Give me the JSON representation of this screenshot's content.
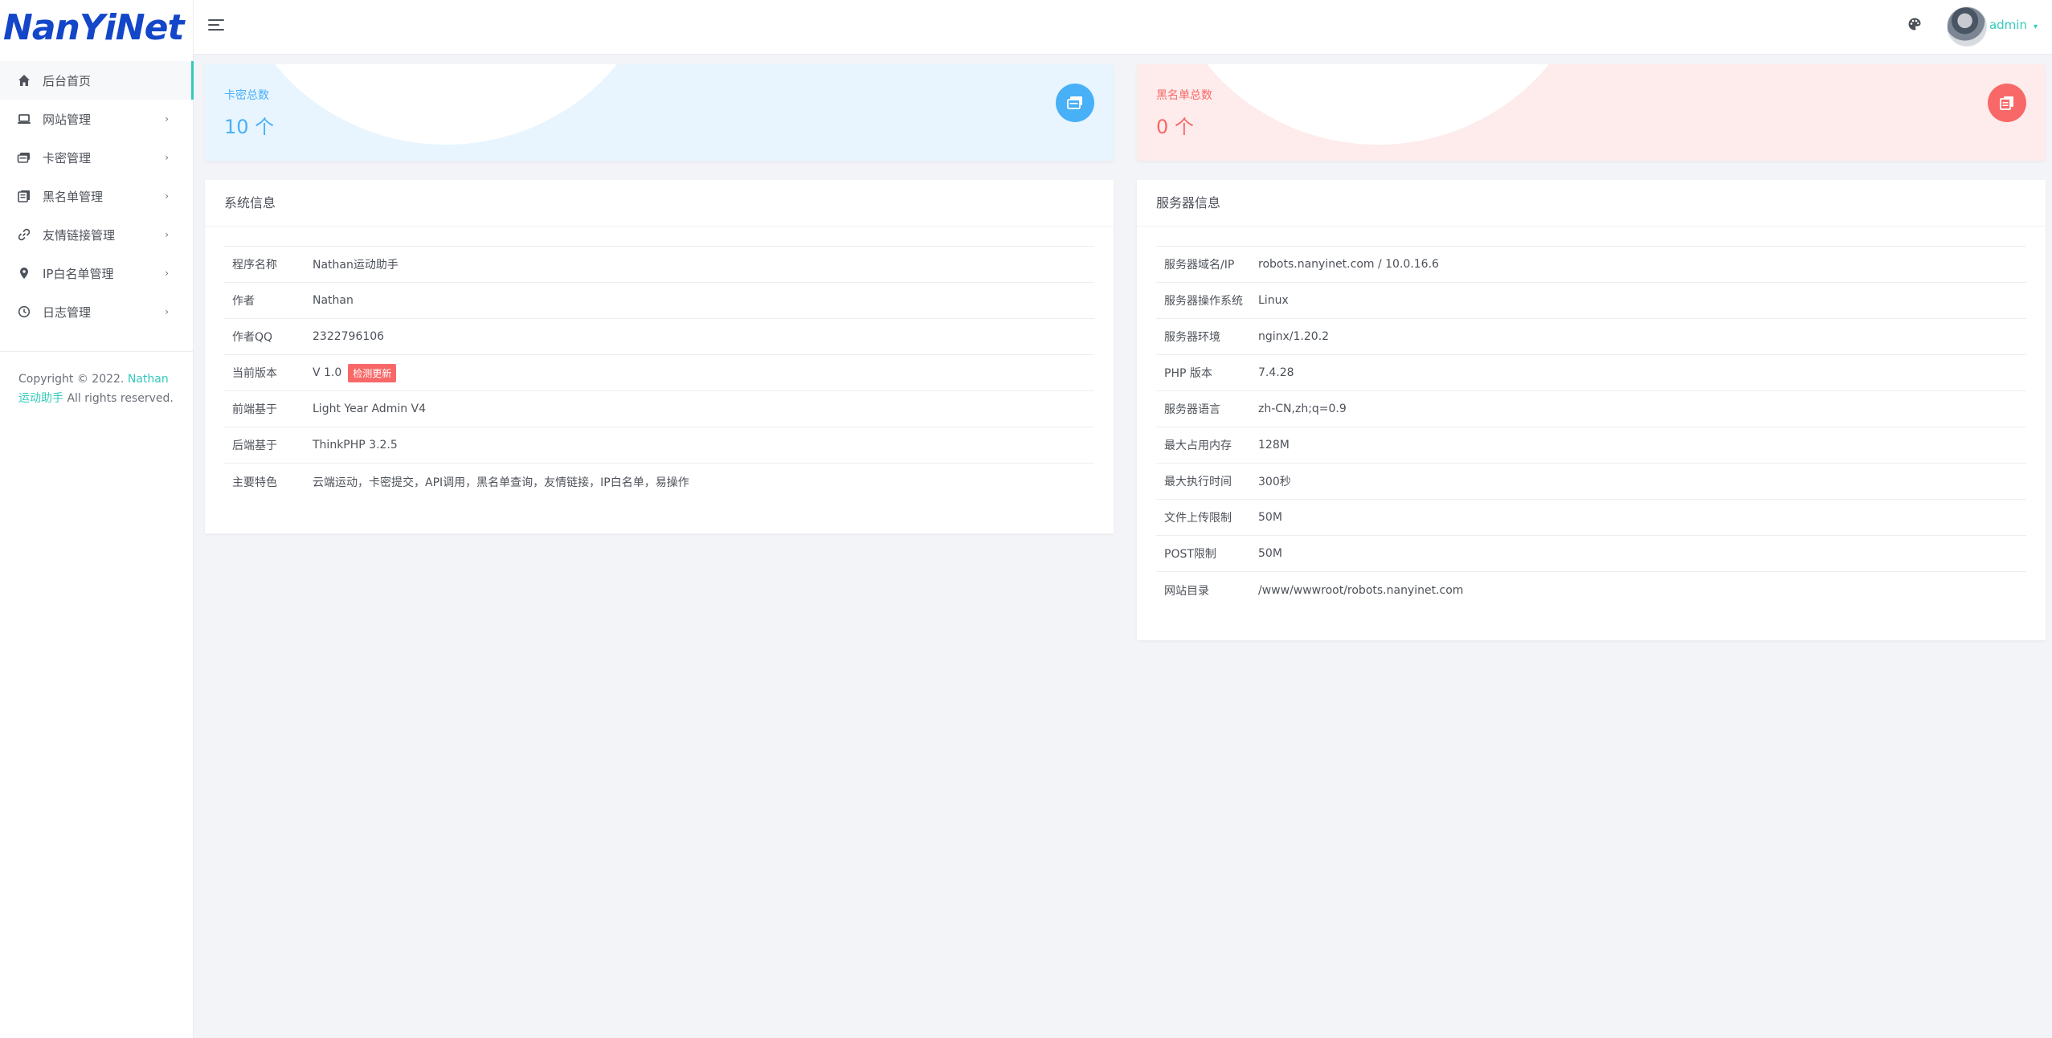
{
  "brand": {
    "logo_text": "NanYiNet"
  },
  "sidebar": {
    "items": [
      {
        "label": "后台首页",
        "icon": "home-icon",
        "active": true
      },
      {
        "label": "网站管理",
        "icon": "laptop-icon"
      },
      {
        "label": "卡密管理",
        "icon": "card-icon"
      },
      {
        "label": "黑名单管理",
        "icon": "book-icon"
      },
      {
        "label": "友情链接管理",
        "icon": "link-icon"
      },
      {
        "label": "IP白名单管理",
        "icon": "map-pin-icon"
      },
      {
        "label": "日志管理",
        "icon": "clock-icon"
      }
    ],
    "arrow": "›",
    "copyright": {
      "prefix": "Copyright © 2022. ",
      "link_text": "Nathan运动助手",
      "suffix": " All rights reserved."
    }
  },
  "header": {
    "username": "admin",
    "caret": "▾"
  },
  "stats": {
    "cards": {
      "label": "卡密总数",
      "value": "10 个",
      "icon": "cards-icon",
      "color": "#48b0f7"
    },
    "blacklist": {
      "label": "黑名单总数",
      "value": "0 个",
      "icon": "list-icon",
      "color": "#f96868"
    }
  },
  "system_info": {
    "title": "系统信息",
    "rows": [
      {
        "key": "程序名称",
        "value": "Nathan运动助手"
      },
      {
        "key": "作者",
        "value": "Nathan"
      },
      {
        "key": "作者QQ",
        "value": "2322796106"
      },
      {
        "key": "当前版本",
        "value": "V 1.0",
        "badge": "检测更新"
      },
      {
        "key": "前端基于",
        "value": "Light Year Admin V4"
      },
      {
        "key": "后端基于",
        "value": "ThinkPHP 3.2.5"
      },
      {
        "key": "主要特色",
        "value": "云端运动，卡密提交，API调用，黑名单查询，友情链接，IP白名单，易操作"
      }
    ]
  },
  "server_info": {
    "title": "服务器信息",
    "rows": [
      {
        "key": "服务器域名/IP",
        "value": "robots.nanyinet.com / 10.0.16.6"
      },
      {
        "key": "服务器操作系统",
        "value": "Linux"
      },
      {
        "key": "服务器环境",
        "value": "nginx/1.20.2"
      },
      {
        "key": "PHP 版本",
        "value": "7.4.28"
      },
      {
        "key": "服务器语言",
        "value": "zh-CN,zh;q=0.9"
      },
      {
        "key": "最大占用内存",
        "value": "128M"
      },
      {
        "key": "最大执行时间",
        "value": "300秒"
      },
      {
        "key": "文件上传限制",
        "value": "50M"
      },
      {
        "key": "POST限制",
        "value": "50M"
      },
      {
        "key": "网站目录",
        "value": "/www/wwwroot/robots.nanyinet.com"
      }
    ]
  },
  "colors": {
    "accent": "#33cabb",
    "logo": "#1346c8",
    "info_blue": "#48b0f7",
    "danger_red": "#f96868"
  }
}
